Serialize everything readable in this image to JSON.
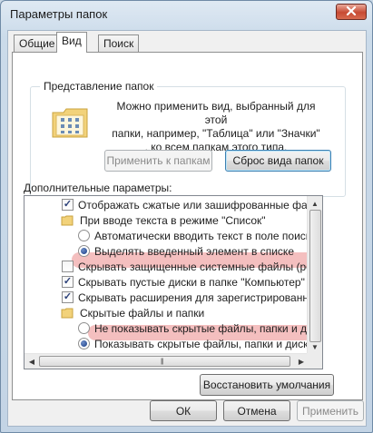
{
  "window": {
    "title": "Параметры папок"
  },
  "tabs": [
    {
      "label": "Общие",
      "active": false
    },
    {
      "label": "Вид",
      "active": true
    },
    {
      "label": "Поиск",
      "active": false
    }
  ],
  "folder_views": {
    "group_title": "Представление папок",
    "description_line1": "Можно применить вид, выбранный для этой",
    "description_line2": "папки, например, \"Таблица\" или \"Значки\"",
    "description_line3": ", ко всем папкам этого типа.",
    "apply_button": "Применить к папкам",
    "reset_button": "Сброс вида папок"
  },
  "advanced": {
    "label": "Дополнительные параметры:",
    "items": [
      {
        "type": "checkbox",
        "checked": true,
        "label": "Отображать сжатые или зашифрованные файлы NTF"
      },
      {
        "type": "folder",
        "label": "При вводе текста в режиме \"Список\""
      },
      {
        "type": "radio",
        "checked": false,
        "label": "Автоматически вводить текст в поле поиска"
      },
      {
        "type": "radio",
        "checked": true,
        "label": "Выделять введенный элемент в списке"
      },
      {
        "type": "checkbox",
        "checked": false,
        "highlight": true,
        "label": "Скрывать защищенные системные файлы (рекомен,"
      },
      {
        "type": "checkbox",
        "checked": true,
        "label": "Скрывать пустые диски в папке \"Компьютер\""
      },
      {
        "type": "checkbox",
        "checked": true,
        "label": "Скрывать расширения для зарегистрированных типо"
      },
      {
        "type": "folder",
        "label": "Скрытые файлы и папки"
      },
      {
        "type": "radio",
        "checked": false,
        "label": "Не показывать скрытые файлы, папки и диски"
      },
      {
        "type": "radio",
        "checked": true,
        "highlight": true,
        "label": "Показывать скрытые файлы, папки и диски"
      }
    ],
    "restore_button": "Восстановить умолчания"
  },
  "footer": {
    "ok_button": "ОК",
    "cancel_button": "Отмена",
    "apply_button": "Применить"
  },
  "colors": {
    "highlight": "#f3bcbc",
    "check": "#2a3f78",
    "close": "#c74a33"
  }
}
